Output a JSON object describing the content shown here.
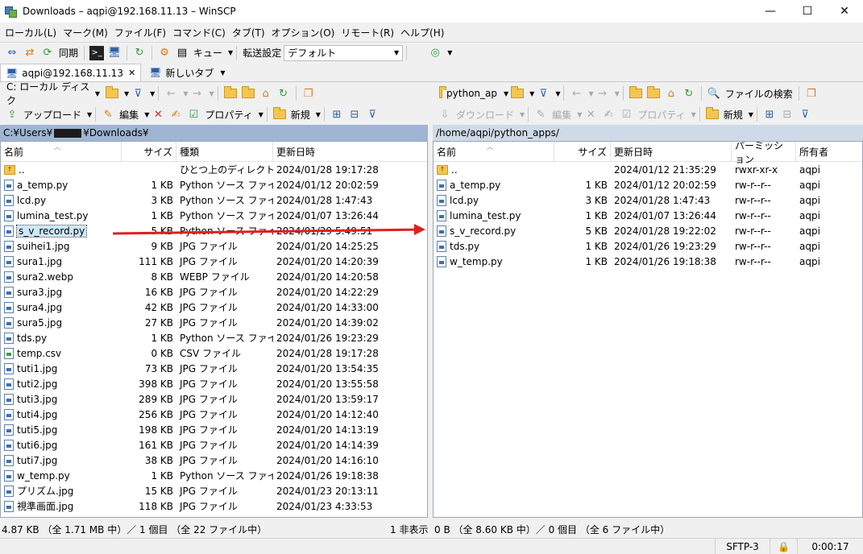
{
  "window": {
    "title": "Downloads – aqpi@192.168.11.13 – WinSCP",
    "minimize": "—",
    "maximize": "☐",
    "close": "✕"
  },
  "menu": [
    "ローカル(L)",
    "マーク(M)",
    "ファイル(F)",
    "コマンド(C)",
    "タブ(T)",
    "オプション(O)",
    "リモート(R)",
    "ヘルプ(H)"
  ],
  "toolbar": {
    "sync_label": "同期",
    "queue_label": "キュー",
    "transfer_settings_label": "転送設定",
    "transfer_preset": "デフォルト"
  },
  "tabs": {
    "session": "aqpi@192.168.11.13",
    "new_tab": "新しいタブ"
  },
  "left_pane": {
    "drive": "C: ローカル ディスク",
    "upload_label": "アップロード",
    "edit_label": "編集",
    "properties_label": "プロパティ",
    "new_label": "新規",
    "path_prefix": "C:¥Users¥",
    "path_suffix": "¥Downloads¥",
    "columns": {
      "name": "名前",
      "size": "サイズ",
      "type": "種類",
      "modified": "更新日時"
    },
    "rows": [
      {
        "name": "..",
        "size": "",
        "type": "ひとつ上のディレクトリ",
        "modified": "2024/01/28 19:17:28",
        "icon": "up"
      },
      {
        "name": "a_temp.py",
        "size": "1 KB",
        "type": "Python ソース ファイル",
        "modified": "2024/01/12 20:02:59",
        "icon": "file"
      },
      {
        "name": "lcd.py",
        "size": "3 KB",
        "type": "Python ソース ファイル",
        "modified": "2024/01/28 1:47:43",
        "icon": "file"
      },
      {
        "name": "lumina_test.py",
        "size": "1 KB",
        "type": "Python ソース ファイル",
        "modified": "2024/01/07 13:26:44",
        "icon": "file"
      },
      {
        "name": "s_v_record.py",
        "size": "5 KB",
        "type": "Python ソース ファイル",
        "modified": "2024/01/29 5:49:51",
        "icon": "file",
        "selected": true
      },
      {
        "name": "suihei1.jpg",
        "size": "9 KB",
        "type": "JPG ファイル",
        "modified": "2024/01/20 14:25:25",
        "icon": "file"
      },
      {
        "name": "sura1.jpg",
        "size": "111 KB",
        "type": "JPG ファイル",
        "modified": "2024/01/20 14:20:39",
        "icon": "file"
      },
      {
        "name": "sura2.webp",
        "size": "8 KB",
        "type": "WEBP ファイル",
        "modified": "2024/01/20 14:20:58",
        "icon": "file"
      },
      {
        "name": "sura3.jpg",
        "size": "16 KB",
        "type": "JPG ファイル",
        "modified": "2024/01/20 14:22:29",
        "icon": "file"
      },
      {
        "name": "sura4.jpg",
        "size": "42 KB",
        "type": "JPG ファイル",
        "modified": "2024/01/20 14:33:00",
        "icon": "file"
      },
      {
        "name": "sura5.jpg",
        "size": "27 KB",
        "type": "JPG ファイル",
        "modified": "2024/01/20 14:39:02",
        "icon": "file"
      },
      {
        "name": "tds.py",
        "size": "1 KB",
        "type": "Python ソース ファイル",
        "modified": "2024/01/26 19:23:29",
        "icon": "file"
      },
      {
        "name": "temp.csv",
        "size": "0 KB",
        "type": "CSV ファイル",
        "modified": "2024/01/28 19:17:28",
        "icon": "csv"
      },
      {
        "name": "tuti1.jpg",
        "size": "73 KB",
        "type": "JPG ファイル",
        "modified": "2024/01/20 13:54:35",
        "icon": "file"
      },
      {
        "name": "tuti2.jpg",
        "size": "398 KB",
        "type": "JPG ファイル",
        "modified": "2024/01/20 13:55:58",
        "icon": "file"
      },
      {
        "name": "tuti3.jpg",
        "size": "289 KB",
        "type": "JPG ファイル",
        "modified": "2024/01/20 13:59:17",
        "icon": "file"
      },
      {
        "name": "tuti4.jpg",
        "size": "256 KB",
        "type": "JPG ファイル",
        "modified": "2024/01/20 14:12:40",
        "icon": "file"
      },
      {
        "name": "tuti5.jpg",
        "size": "198 KB",
        "type": "JPG ファイル",
        "modified": "2024/01/20 14:13:19",
        "icon": "file"
      },
      {
        "name": "tuti6.jpg",
        "size": "161 KB",
        "type": "JPG ファイル",
        "modified": "2024/01/20 14:14:39",
        "icon": "file"
      },
      {
        "name": "tuti7.jpg",
        "size": "38 KB",
        "type": "JPG ファイル",
        "modified": "2024/01/20 14:16:10",
        "icon": "file"
      },
      {
        "name": "w_temp.py",
        "size": "1 KB",
        "type": "Python ソース ファイル",
        "modified": "2024/01/26 19:18:38",
        "icon": "file"
      },
      {
        "name": "プリズム.jpg",
        "size": "15 KB",
        "type": "JPG ファイル",
        "modified": "2024/01/23 20:13:11",
        "icon": "file"
      },
      {
        "name": "視準画面.jpg",
        "size": "118 KB",
        "type": "JPG ファイル",
        "modified": "2024/01/23 4:33:53",
        "icon": "file"
      }
    ]
  },
  "right_pane": {
    "folder": "python_ap",
    "find_files_label": "ファイルの検索",
    "download_label": "ダウンロード",
    "edit_label": "編集",
    "properties_label": "プロパティ",
    "new_label": "新規",
    "path": "/home/aqpi/python_apps/",
    "columns": {
      "name": "名前",
      "size": "サイズ",
      "modified": "更新日時",
      "permissions": "パーミッション",
      "owner": "所有者"
    },
    "rows": [
      {
        "name": "..",
        "size": "",
        "modified": "2024/01/12 21:35:29",
        "permissions": "rwxr-xr-x",
        "owner": "aqpi",
        "icon": "up"
      },
      {
        "name": "a_temp.py",
        "size": "1 KB",
        "modified": "2024/01/12 20:02:59",
        "permissions": "rw-r--r--",
        "owner": "aqpi",
        "icon": "file"
      },
      {
        "name": "lcd.py",
        "size": "3 KB",
        "modified": "2024/01/28 1:47:43",
        "permissions": "rw-r--r--",
        "owner": "aqpi",
        "icon": "file"
      },
      {
        "name": "lumina_test.py",
        "size": "1 KB",
        "modified": "2024/01/07 13:26:44",
        "permissions": "rw-r--r--",
        "owner": "aqpi",
        "icon": "file"
      },
      {
        "name": "s_v_record.py",
        "size": "5 KB",
        "modified": "2024/01/28 19:22:02",
        "permissions": "rw-r--r--",
        "owner": "aqpi",
        "icon": "file"
      },
      {
        "name": "tds.py",
        "size": "1 KB",
        "modified": "2024/01/26 19:23:29",
        "permissions": "rw-r--r--",
        "owner": "aqpi",
        "icon": "file"
      },
      {
        "name": "w_temp.py",
        "size": "1 KB",
        "modified": "2024/01/26 19:18:38",
        "permissions": "rw-r--r--",
        "owner": "aqpi",
        "icon": "file"
      }
    ]
  },
  "status": {
    "left": "4.87 KB （全 1.71 MB 中）／ 1 個目 （全 22 ファイル中）",
    "hidden": "1 非表示",
    "right": "0 B （全 8.60 KB 中）／ 0 個目 （全 6 ファイル中）",
    "protocol": "SFTP-3",
    "lock": "🔒",
    "timer": "0:00:17"
  },
  "colors": {
    "left_path_bg": "#9fb5d3",
    "right_path_bg": "#cfdae8",
    "arrow": "#e02020"
  }
}
